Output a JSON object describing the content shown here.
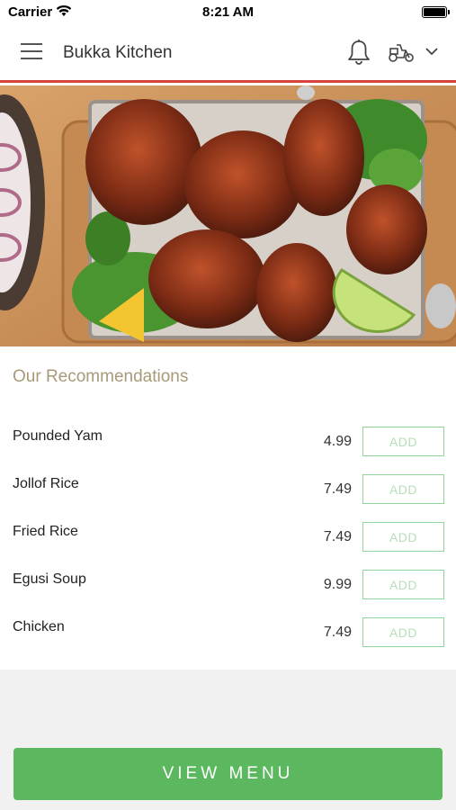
{
  "status_bar": {
    "carrier": "Carrier",
    "time": "8:21 AM"
  },
  "header": {
    "title": "Bukka Kitchen",
    "accent_color": "#d9433f"
  },
  "hero": {
    "image_subject": "grilled chicken platter"
  },
  "recommendations": {
    "title": "Our Recommendations",
    "add_label": "ADD",
    "items": [
      {
        "name": "Pounded Yam",
        "price": "4.99"
      },
      {
        "name": "Jollof Rice",
        "price": "7.49"
      },
      {
        "name": "Fried Rice",
        "price": "7.49"
      },
      {
        "name": "Egusi Soup",
        "price": "9.99"
      },
      {
        "name": "Chicken",
        "price": "7.49"
      }
    ]
  },
  "footer": {
    "view_menu_label": "VIEW MENU",
    "button_color": "#5cb85f"
  },
  "icons": {
    "menu": "hamburger-menu-icon",
    "notifications": "bell-icon",
    "delivery": "scooter-icon",
    "dropdown": "chevron-down-icon"
  }
}
